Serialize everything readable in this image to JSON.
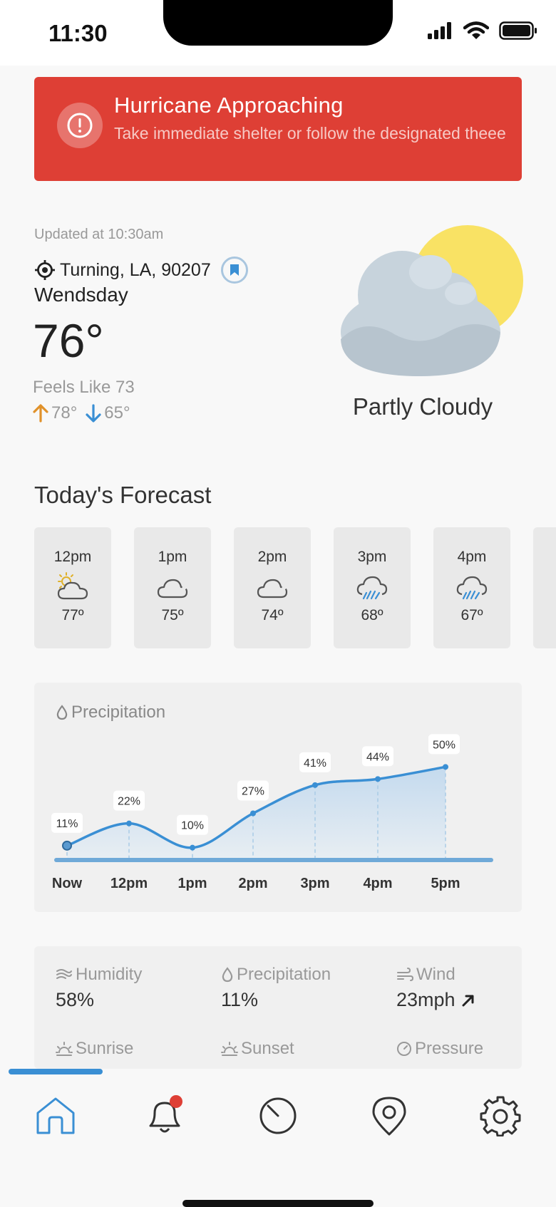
{
  "status": {
    "time": "11:30"
  },
  "alert": {
    "title": "Hurricane Approaching",
    "message": "Take immediate shelter or follow the designated theee"
  },
  "current": {
    "updated": "Updated at 10:30am",
    "location": "Turning, LA, 90207",
    "day": "Wendsday",
    "temp": "76°",
    "feels_like": "Feels Like 73",
    "high": "78°",
    "low": "65°",
    "condition": "Partly Cloudy"
  },
  "forecast": {
    "title": "Today's Forecast",
    "hours": [
      {
        "label": "12pm",
        "temp": "77º",
        "icon": "partly-sunny-icon"
      },
      {
        "label": "1pm",
        "temp": "75º",
        "icon": "cloud-icon"
      },
      {
        "label": "2pm",
        "temp": "74º",
        "icon": "cloud-icon"
      },
      {
        "label": "3pm",
        "temp": "68º",
        "icon": "rain-cloud-icon"
      },
      {
        "label": "4pm",
        "temp": "67º",
        "icon": "rain-cloud-icon"
      }
    ]
  },
  "precipitation_card": {
    "title": "Precipitation"
  },
  "chart_data": {
    "type": "area",
    "categories": [
      "Now",
      "12pm",
      "1pm",
      "2pm",
      "3pm",
      "4pm",
      "5pm"
    ],
    "values": [
      11,
      22,
      10,
      27,
      41,
      44,
      50
    ],
    "labels": [
      "11%",
      "22%",
      "10%",
      "27%",
      "41%",
      "44%",
      "50%"
    ],
    "ylim": [
      0,
      60
    ],
    "colors": {
      "line": "#3a8fd4",
      "fill": "#cfe0ef"
    }
  },
  "details": {
    "humidity": {
      "label": "Humidity",
      "value": "58%"
    },
    "precipitation": {
      "label": "Precipitation",
      "value": "11%"
    },
    "wind": {
      "label": "Wind",
      "value": "23mph"
    },
    "sunrise": {
      "label": "Sunrise"
    },
    "sunset": {
      "label": "Sunset"
    },
    "pressure": {
      "label": "Pressure"
    }
  },
  "colors": {
    "alert": "#de3f35",
    "accent": "#3a8fd4",
    "high_arrow": "#e0912a",
    "low_arrow": "#3a8fd4"
  }
}
